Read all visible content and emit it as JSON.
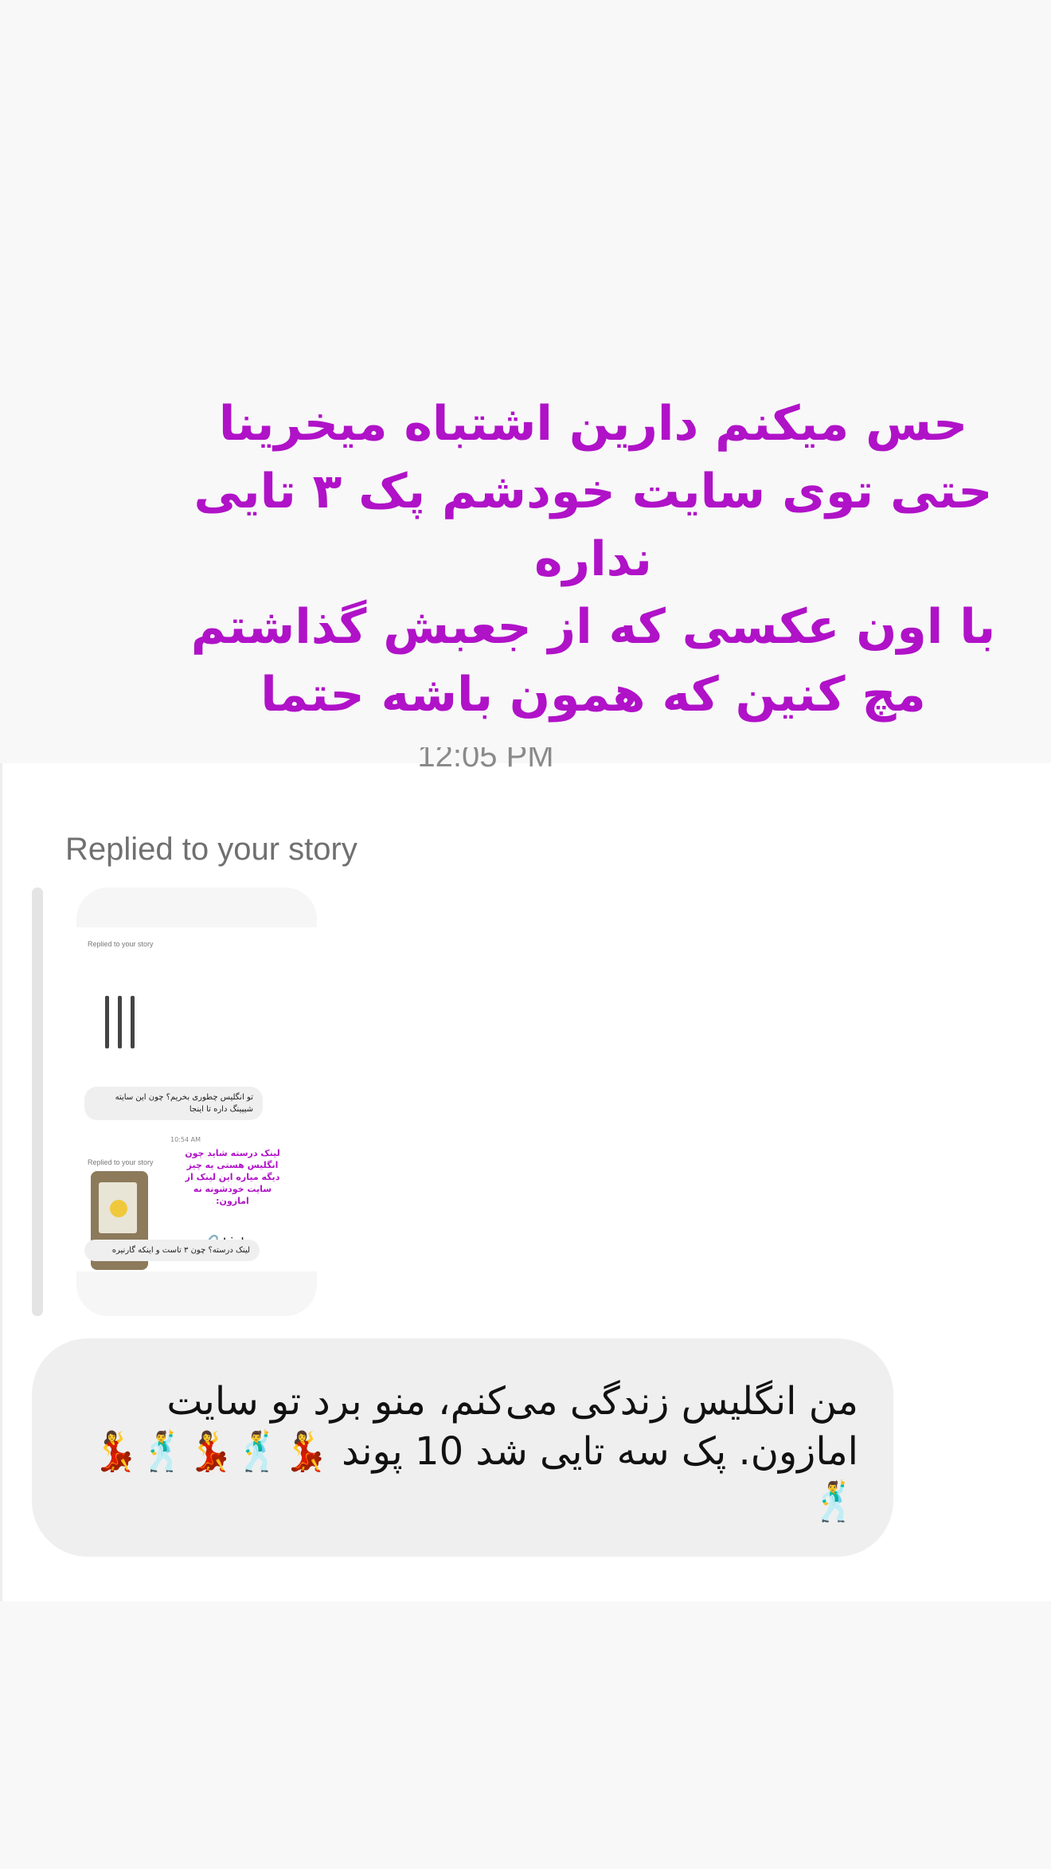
{
  "overlay_text": {
    "lines": [
      "حس میکنم دارین اشتباه میخرینا",
      "حتی توی سایت خودشم پک ۳ تایی",
      "نداره",
      "با اون عکسی که از جعبش گذاشتم",
      "مچ کنین که همون باشه حتما"
    ],
    "color": "#b012c8"
  },
  "timestamp": "12:05 PM",
  "reply": {
    "label": "Replied to your story"
  },
  "story_preview": {
    "replied_label_1": "Replied to your story",
    "bubble_1": "تو انگلیس چطوری بخریم؟ چون این سایته شیپینگ داره تا اینجا",
    "time": "10:54 AM",
    "replied_label_2": "Replied to your story",
    "purple_text": "لینک درسته شاید چون انگلیس هستی یه چیز دیگه میاره این لینک از سایت خودشونه نه امازون:",
    "link_label": "Link",
    "bubble_2": "لینک درسته؟ چون ۳ تاست و اینکه گارنیره"
  },
  "message": {
    "text": "من انگلیس زندگی می‌کنم، منو برد تو سایت امازون. پک سه تایی شد 10 پوند",
    "emojis": "💃🕺💃🕺💃🕺"
  },
  "colors": {
    "accent_purple": "#b012c8",
    "bubble_bg": "#efefef",
    "page_bg": "#f8f8f8"
  }
}
